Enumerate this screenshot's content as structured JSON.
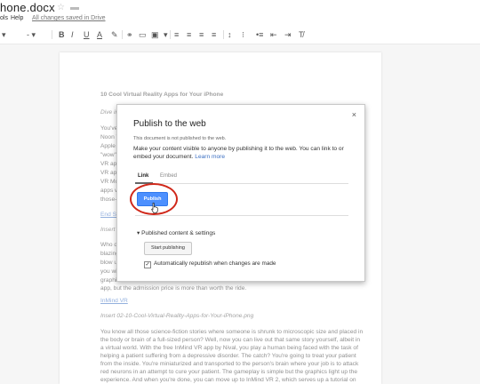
{
  "app": {
    "doc_title": "hone.docx",
    "saved_status": "All changes saved in Drive",
    "menu": [
      "ols",
      "Help"
    ]
  },
  "toolbar": {
    "undo": "↶",
    "style": "",
    "bold": "B",
    "italic": "I",
    "underline": "U",
    "text_color": "A"
  },
  "document": {
    "lines": [
      {
        "text": "10 Cool Virtual Reality Apps for Your iPhone",
        "style": "h"
      },
      {
        "text": "Dive in",
        "style": "i"
      },
      {
        "text": "You've",
        "style": ""
      },
      {
        "text": "Noon V",
        "style": ""
      },
      {
        "text": "Apple",
        "style": ""
      },
      {
        "text": "\"wow\"",
        "style": ""
      },
      {
        "text": "VR app",
        "style": ""
      },
      {
        "text": "VR app",
        "style": ""
      },
      {
        "text": "VR Mo",
        "style": ""
      },
      {
        "text": "apps w",
        "style": ""
      },
      {
        "text": "those-",
        "style": ""
      },
      {
        "text": "End Sp",
        "style": "link"
      },
      {
        "text": "Insert",
        "style": "i"
      },
      {
        "text": "Who d",
        "style": ""
      },
      {
        "text": "blazing",
        "style": ""
      },
      {
        "text": "blow u",
        "style": ""
      },
      {
        "text": "you wi",
        "style": ""
      },
      {
        "text": "graphi",
        "style": ""
      },
      {
        "text": "app, but the admission price is more than worth the ride.",
        "style": ""
      },
      {
        "text": "InMind VR",
        "style": "link"
      },
      {
        "text": "Insert 02-10-Cool-Virtual-Reality-Apps-for-Your-iPhone.png",
        "style": "i"
      },
      {
        "text": "You know all those science-fiction stories where someone is shrunk to microscopic size and placed in",
        "style": ""
      },
      {
        "text": "the body or brain of a full-sized person? Well, now you can live out that same story yourself, albeit in",
        "style": ""
      },
      {
        "text": "a virtual world. With the free InMind VR app by Nival, you play a human being faced with the task of",
        "style": ""
      },
      {
        "text": "helping a patient suffering from a depressive disorder. The catch? You're going to treat your patient",
        "style": ""
      },
      {
        "text": "from the inside. You're miniaturized and transported to the person's brain where your job is to attack",
        "style": ""
      },
      {
        "text": "red neurons in an attempt to cure your patient. The gameplay is simple but the graphics light up the",
        "style": ""
      },
      {
        "text": "experience. And when you're done, you can move up to InMind VR 2, which serves up a tutorial on",
        "style": ""
      }
    ]
  },
  "dialog": {
    "title": "Publish to the web",
    "close": "×",
    "status": "This document is not published to the web.",
    "description": "Make your content visible to anyone by publishing it to the web. You can link to or embed your document.",
    "learn_more": "Learn more",
    "tabs": [
      "Link",
      "Embed"
    ],
    "publish_label": "Publish",
    "section_label": "▾  Published content & settings",
    "start_publishing": "Start publishing",
    "auto_republish": "Automatically republish when changes are made",
    "auto_republish_checked": true
  }
}
